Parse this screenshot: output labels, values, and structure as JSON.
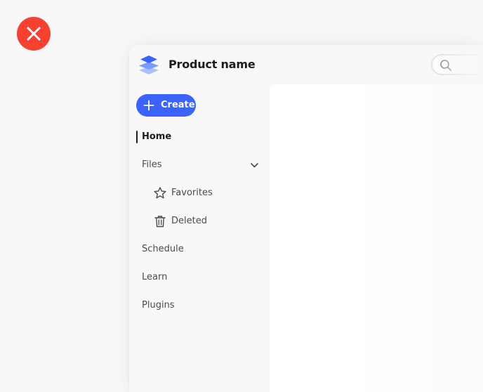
{
  "colors": {
    "close_badge": "#f6412f",
    "primary": "#3b63fb",
    "text_primary": "#1d1d1d",
    "text_secondary": "#4b4b4b"
  },
  "close_badge": {
    "icon": "close-icon"
  },
  "header": {
    "logo_icon": "layers-logo-icon",
    "product_name": "Product name",
    "search_icon": "search-icon"
  },
  "sidebar": {
    "create_button": {
      "icon": "plus-icon",
      "label": "Create"
    },
    "items": [
      {
        "label": "Home",
        "selected": true
      },
      {
        "label": "Files",
        "expandable": true,
        "expanded": true,
        "chevron_icon": "chevron-down-icon"
      },
      {
        "label": "Favorites",
        "icon": "star-icon",
        "indent": true
      },
      {
        "label": "Deleted",
        "icon": "trash-icon",
        "indent": true
      },
      {
        "label": "Schedule"
      },
      {
        "label": "Learn"
      },
      {
        "label": "Plugins"
      }
    ]
  }
}
